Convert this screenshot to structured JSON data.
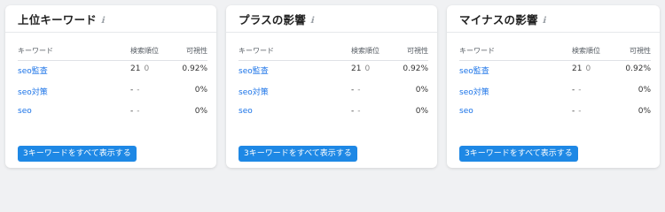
{
  "cards": [
    {
      "title": "上位キーワード",
      "info_icon": "ℹ",
      "headers": {
        "keyword": "キーワード",
        "rank": "検索順位",
        "visibility": "可視性"
      },
      "rows": [
        {
          "keyword": "seo監査",
          "rank": "21",
          "change": "0",
          "visibility": "0.92%"
        },
        {
          "keyword": "seo対策",
          "rank": "-",
          "change": "-",
          "visibility": "0%"
        },
        {
          "keyword": "seo",
          "rank": "-",
          "change": "-",
          "visibility": "0%"
        }
      ],
      "button_label": "3キーワードをすべて表示する"
    },
    {
      "title": "プラスの影響",
      "info_icon": "ℹ",
      "headers": {
        "keyword": "キーワード",
        "rank": "検索順位",
        "visibility": "可視性"
      },
      "rows": [
        {
          "keyword": "seo監査",
          "rank": "21",
          "change": "0",
          "visibility": "0.92%"
        },
        {
          "keyword": "seo対策",
          "rank": "-",
          "change": "-",
          "visibility": "0%"
        },
        {
          "keyword": "seo",
          "rank": "-",
          "change": "-",
          "visibility": "0%"
        }
      ],
      "button_label": "3キーワードをすべて表示する"
    },
    {
      "title": "マイナスの影響",
      "info_icon": "ℹ",
      "headers": {
        "keyword": "キーワード",
        "rank": "検索順位",
        "visibility": "可視性"
      },
      "rows": [
        {
          "keyword": "seo監査",
          "rank": "21",
          "change": "0",
          "visibility": "0.92%"
        },
        {
          "keyword": "seo対策",
          "rank": "-",
          "change": "-",
          "visibility": "0%"
        },
        {
          "keyword": "seo",
          "rank": "-",
          "change": "-",
          "visibility": "0%"
        }
      ],
      "button_label": "3キーワードをすべて表示する"
    }
  ],
  "colors": {
    "link": "#1a73e8",
    "button": "#1e88e5",
    "background": "#f0f1f3"
  }
}
